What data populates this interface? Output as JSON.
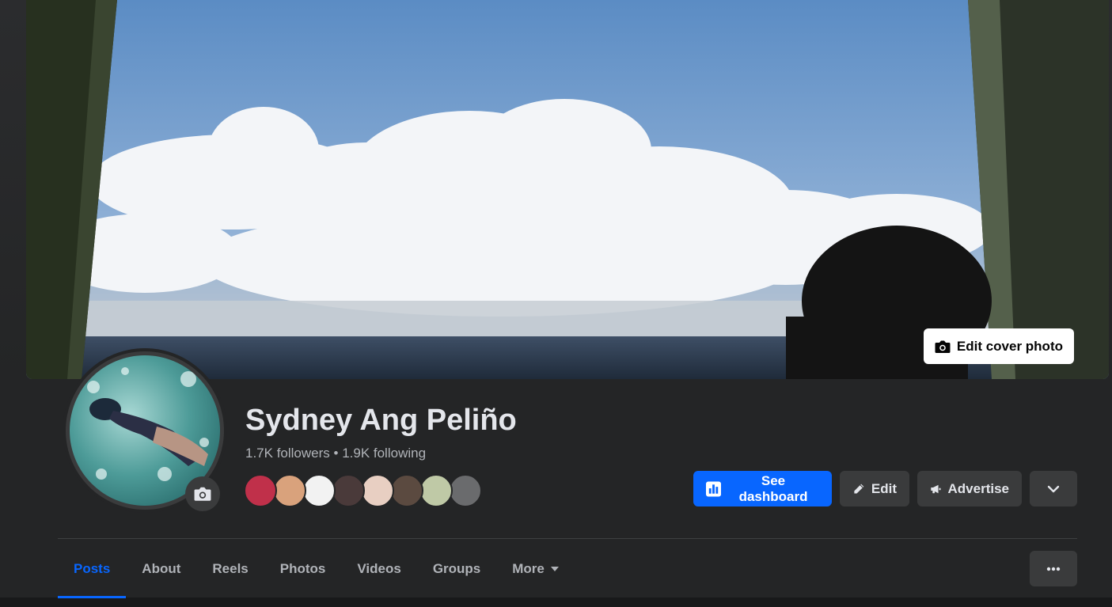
{
  "cover": {
    "edit_label": "Edit cover photo",
    "icon": "camera-icon"
  },
  "profile": {
    "name": "Sydney Ang Peliño",
    "followers": "1.7K followers",
    "separator": " • ",
    "following": "1.9K following",
    "avatar_edit_icon": "camera-icon",
    "friends": [
      {
        "avatar": "friend-avatar-red",
        "color": "#c0304a"
      },
      {
        "avatar": "friend-avatar-cartoon",
        "color": "#d9a27c"
      },
      {
        "avatar": "friend-avatar-text",
        "color": "#f2f2f2"
      },
      {
        "avatar": "friend-avatar-dark",
        "color": "#4a3a3a"
      },
      {
        "avatar": "friend-avatar-light",
        "color": "#e8cfc2"
      },
      {
        "avatar": "friend-avatar-group",
        "color": "#5b4a40"
      },
      {
        "avatar": "friend-avatar-outdoor",
        "color": "#bfc9a6"
      },
      {
        "avatar": "friend-avatar-default",
        "color": "#6a6b6d"
      }
    ]
  },
  "actions": {
    "dashboard_label": "See dashboard",
    "dashboard_icon": "chart-icon",
    "edit_label": "Edit",
    "edit_icon": "pencil-icon",
    "advertise_label": "Advertise",
    "advertise_icon": "megaphone-icon",
    "more_icon": "chevron-down-icon"
  },
  "tabs": [
    {
      "label": "Posts",
      "active": true
    },
    {
      "label": "About"
    },
    {
      "label": "Reels"
    },
    {
      "label": "Photos"
    },
    {
      "label": "Videos"
    },
    {
      "label": "Groups"
    },
    {
      "label": "More",
      "has_caret": true
    }
  ],
  "tab_overflow_icon": "ellipsis-icon",
  "colors": {
    "accent": "#0866ff",
    "surface": "#242526",
    "button": "#3a3b3c",
    "text": "#e4e6eb",
    "muted": "#b0b3b8"
  }
}
